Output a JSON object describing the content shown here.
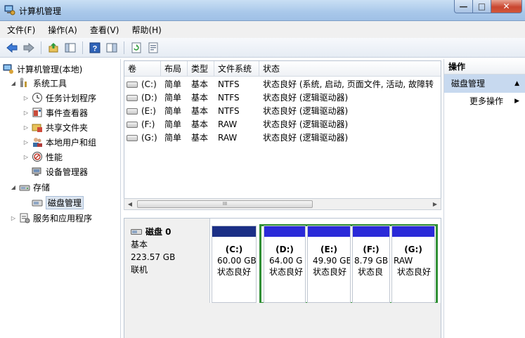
{
  "window": {
    "title": "计算机管理",
    "buttons": {
      "minimize": "—",
      "maximize": "□",
      "close": "✕"
    }
  },
  "menu": [
    "文件(F)",
    "操作(A)",
    "查看(V)",
    "帮助(H)"
  ],
  "toolbar": [
    "back-icon",
    "forward-icon",
    "up-icon",
    "show-hide-tree-icon",
    "help-icon",
    "properties-icon",
    "refresh-icon",
    "export-icon"
  ],
  "tree": {
    "root": "计算机管理(本地)",
    "system_tools": "系统工具",
    "task_scheduler": "任务计划程序",
    "event_viewer": "事件查看器",
    "shared_folders": "共享文件夹",
    "local_users": "本地用户和组",
    "performance": "性能",
    "device_manager": "设备管理器",
    "storage": "存储",
    "disk_management": "磁盘管理",
    "services_apps": "服务和应用程序"
  },
  "volumes": {
    "columns": [
      "卷",
      "布局",
      "类型",
      "文件系统",
      "状态"
    ],
    "rows": [
      {
        "vol": "(C:)",
        "layout": "简单",
        "type": "基本",
        "fs": "NTFS",
        "status": "状态良好 (系统, 启动, 页面文件, 活动, 故障转"
      },
      {
        "vol": "(D:)",
        "layout": "简单",
        "type": "基本",
        "fs": "NTFS",
        "status": "状态良好 (逻辑驱动器)"
      },
      {
        "vol": "(E:)",
        "layout": "简单",
        "type": "基本",
        "fs": "NTFS",
        "status": "状态良好 (逻辑驱动器)"
      },
      {
        "vol": "(F:)",
        "layout": "简单",
        "type": "基本",
        "fs": "RAW",
        "status": "状态良好 (逻辑驱动器)"
      },
      {
        "vol": "(G:)",
        "layout": "简单",
        "type": "基本",
        "fs": "RAW",
        "status": "状态良好 (逻辑驱动器)"
      }
    ],
    "scroll_thumb": "III"
  },
  "disk": {
    "name": "磁盘 0",
    "type": "基本",
    "size": "223.57 GB",
    "status": "联机",
    "partitions": [
      {
        "name": "(C:)",
        "size": "60.00 GB",
        "status": "状态良好"
      },
      {
        "name": "(D:)",
        "size": "64.00 G",
        "status": "状态良好"
      },
      {
        "name": "(E:)",
        "size": "49.90 GB",
        "status": "状态良好"
      },
      {
        "name": "(F:)",
        "size": "8.79 GB",
        "status": "状态良"
      },
      {
        "name": "(G:)",
        "size": "RAW",
        "status": "状态良好"
      }
    ]
  },
  "actions": {
    "header": "操作",
    "section": "磁盘管理",
    "more": "更多操作"
  }
}
